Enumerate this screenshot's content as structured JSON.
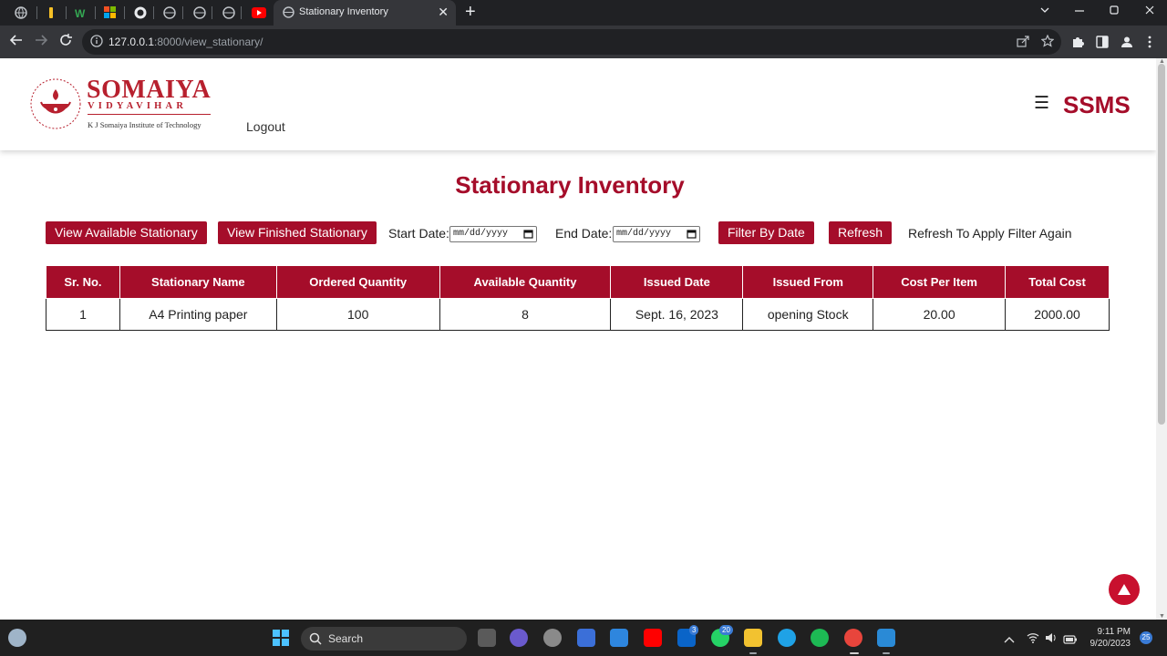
{
  "browser": {
    "tab_title": "Stationary Inventory",
    "url_host": "127.0.0.1",
    "url_path": ":8000/view_stationary/",
    "new_tab_symbol": "+",
    "close_symbol": "✕"
  },
  "header": {
    "logo_word": "SOMAIYA",
    "logo_sub": "VIDYAVIHAR",
    "logo_institute": "K J Somaiya Institute of Technology",
    "logout_label": "Logout",
    "menu_symbol": "☰",
    "brand": "SSMS"
  },
  "main": {
    "title": "Stationary Inventory",
    "view_available_label": "View Available Stationary",
    "view_finished_label": "View Finished Stationary",
    "start_date_label": "Start Date:",
    "start_date_placeholder": "mm/dd/yyyy",
    "end_date_label": "End Date:",
    "end_date_placeholder": "mm/dd/yyyy",
    "filter_label": "Filter By Date",
    "refresh_label": "Refresh",
    "refresh_hint": "Refresh To Apply Filter Again"
  },
  "table": {
    "columns": [
      "Sr. No.",
      "Stationary Name",
      "Ordered Quantity",
      "Available Quantity",
      "Issued Date",
      "Issued From",
      "Cost Per Item",
      "Total Cost"
    ],
    "rows": [
      [
        "1",
        "A4 Printing paper",
        "100",
        "8",
        "Sept. 16, 2023",
        "opening Stock",
        "20.00",
        "2000.00"
      ]
    ]
  },
  "taskbar": {
    "search_label": "Search",
    "time": "9:11 PM",
    "date": "9/20/2023",
    "mail_badge": "3",
    "whatsapp_badge": "20",
    "notification_count": "25"
  },
  "colors": {
    "brand_red": "#a50d2a",
    "logo_red": "#b7202e"
  }
}
